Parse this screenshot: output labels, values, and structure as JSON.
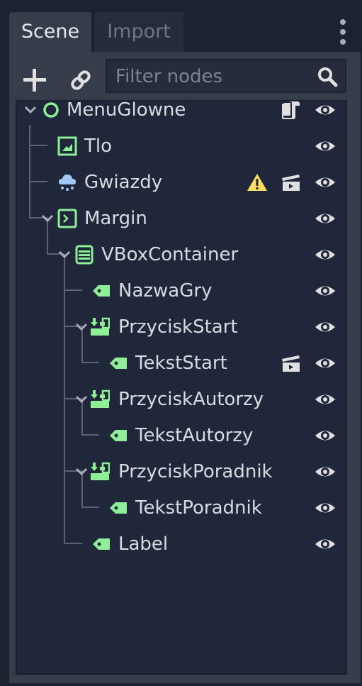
{
  "tabs": {
    "scene": "Scene",
    "import": "Import"
  },
  "toolbar": {
    "filter_placeholder": "Filter nodes"
  },
  "tree": {
    "nodes": [
      {
        "name": "MenuGlowne",
        "type": "node",
        "collapsible": true,
        "script": true,
        "visible": true
      },
      {
        "name": "Tlo",
        "type": "texture-rect",
        "visible": true
      },
      {
        "name": "Gwiazdy",
        "type": "particles",
        "warning": true,
        "scene_instance": true,
        "visible": true
      },
      {
        "name": "Margin",
        "type": "margin-container",
        "collapsible": true,
        "visible": true
      },
      {
        "name": "VBoxContainer",
        "type": "vbox-container",
        "collapsible": true,
        "visible": true
      },
      {
        "name": "NazwaGry",
        "type": "label",
        "visible": true
      },
      {
        "name": "PrzyciskStart",
        "type": "button",
        "collapsible": true,
        "visible": true
      },
      {
        "name": "TekstStart",
        "type": "label",
        "scene_instance": true,
        "visible": true
      },
      {
        "name": "PrzyciskAutorzy",
        "type": "button",
        "collapsible": true,
        "visible": true
      },
      {
        "name": "TekstAutorzy",
        "type": "label",
        "visible": true
      },
      {
        "name": "PrzyciskPoradnik",
        "type": "button",
        "collapsible": true,
        "visible": true
      },
      {
        "name": "TekstPoradnik",
        "type": "label",
        "visible": true
      },
      {
        "name": "Label",
        "type": "label",
        "visible": true
      }
    ]
  },
  "colors": {
    "node_green": "#8eef97",
    "particles_blue": "#a4c8f5",
    "warning_yellow": "#ffdd65",
    "icon_gray": "#e0e0e0"
  }
}
